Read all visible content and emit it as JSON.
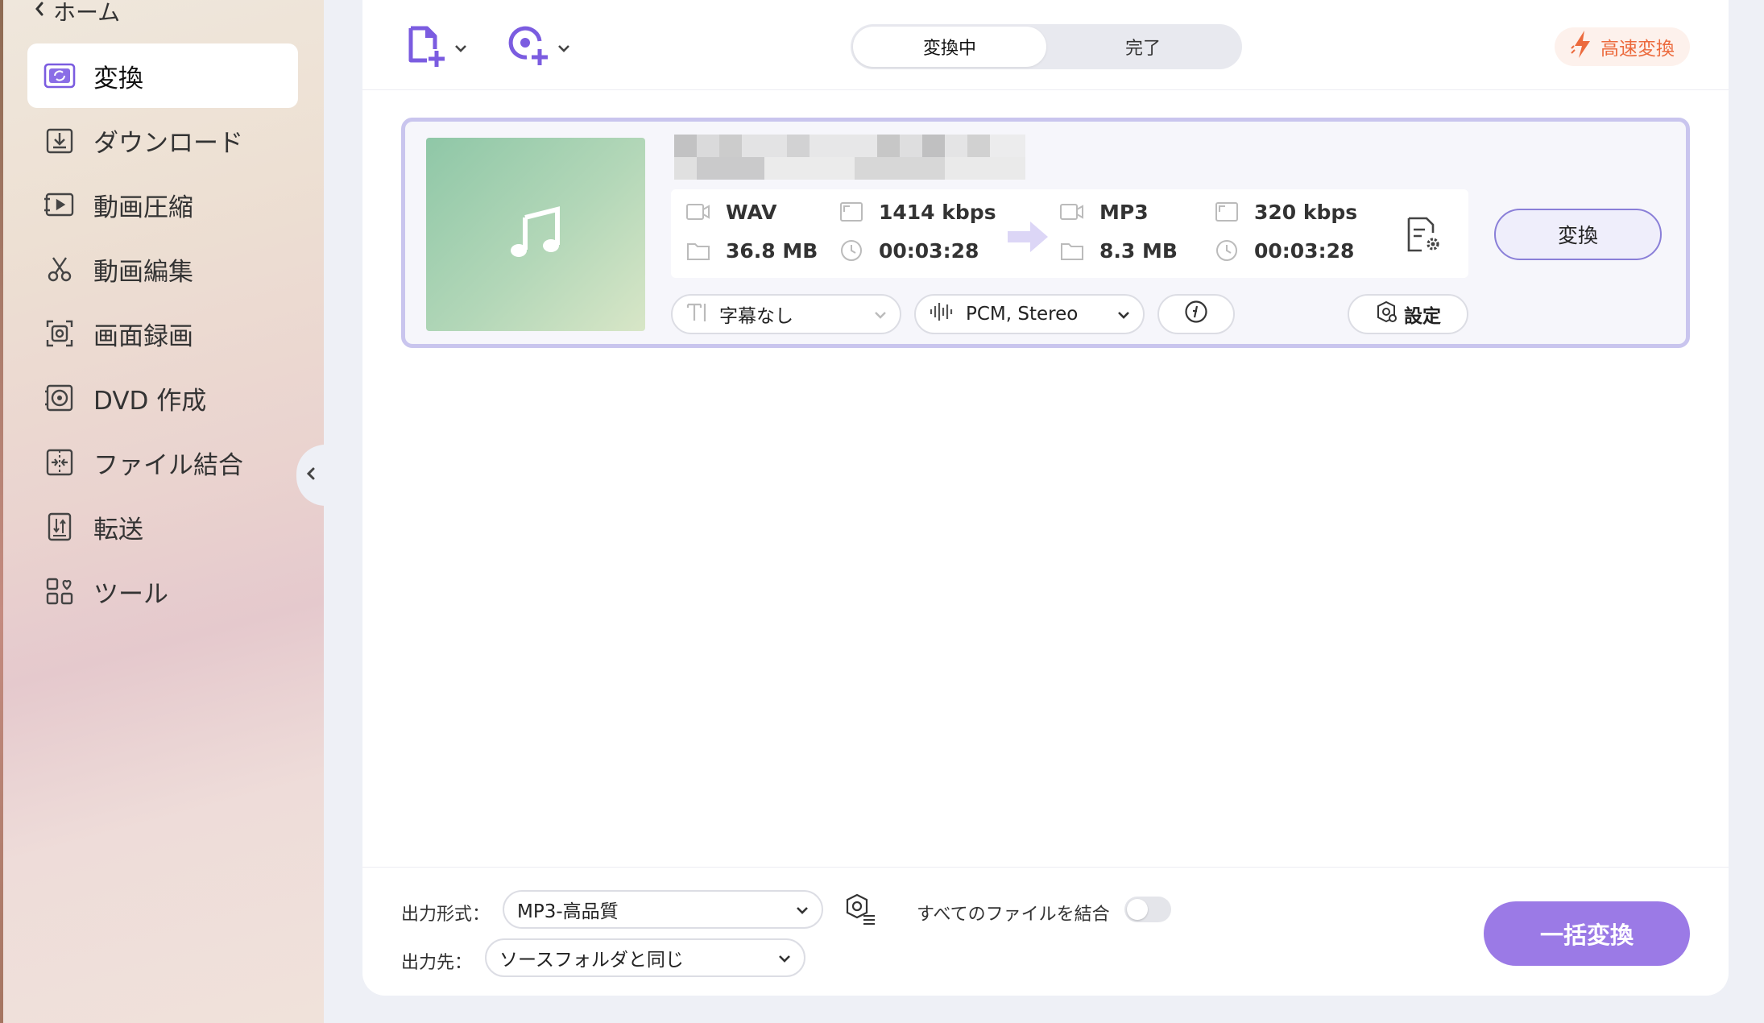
{
  "sidebar": {
    "home_label": "ホーム",
    "items": [
      {
        "label": "変換",
        "icon": "convert-icon",
        "active": true
      },
      {
        "label": "ダウンロード",
        "icon": "download-icon"
      },
      {
        "label": "動画圧縮",
        "icon": "compress-icon"
      },
      {
        "label": "動画編集",
        "icon": "scissors-icon"
      },
      {
        "label": "画面録画",
        "icon": "screen-record-icon"
      },
      {
        "label": "DVD 作成",
        "icon": "dvd-icon"
      },
      {
        "label": "ファイル結合",
        "icon": "merge-icon"
      },
      {
        "label": "転送",
        "icon": "transfer-icon"
      },
      {
        "label": "ツール",
        "icon": "tools-icon"
      }
    ]
  },
  "toolbar": {
    "tabs": {
      "converting": "変換中",
      "done": "完了"
    },
    "fast_convert": "高速変換"
  },
  "file": {
    "source": {
      "format": "WAV",
      "bitrate": "1414 kbps",
      "size": "36.8 MB",
      "duration": "00:03:28"
    },
    "target": {
      "format": "MP3",
      "bitrate": "320 kbps",
      "size": "8.3 MB",
      "duration": "00:03:28"
    },
    "convert_label": "変換",
    "subtitle": "字幕なし",
    "audio": "PCM, Stereo",
    "settings_label": "設定"
  },
  "bottom": {
    "format_label": "出力形式：",
    "format_value": "MP3-高品質",
    "dest_label": "出力先：",
    "dest_value": "ソースフォルダと同じ",
    "merge_label": "すべてのファイルを結合",
    "batch_label": "一括変換"
  },
  "colors": {
    "accent": "#9b7ae6",
    "fast": "#ec6a3d",
    "card_border": "#c9c5ee"
  }
}
